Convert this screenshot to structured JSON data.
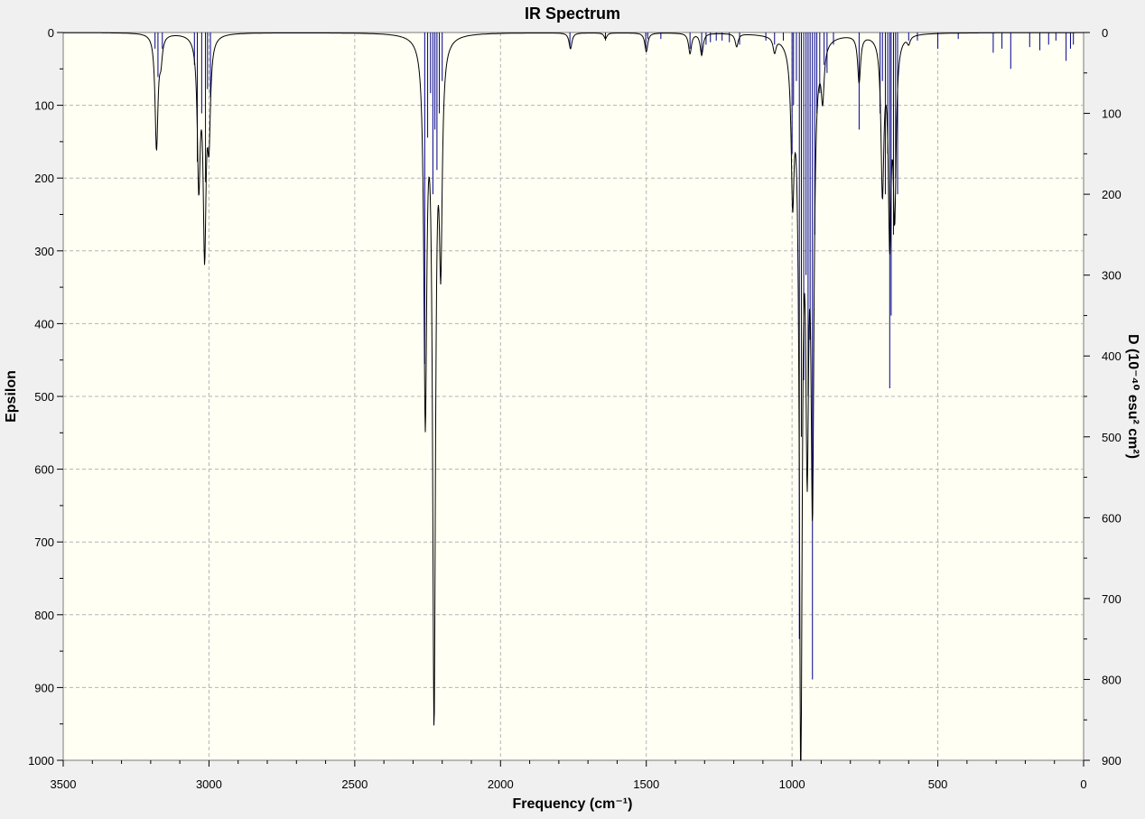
{
  "chart_data": {
    "type": "line",
    "title": "IR Spectrum",
    "xlabel": "Frequency (cm⁻¹)",
    "ylabel": "Epsilon",
    "ylabel_right": "D (10⁻⁴⁰ esu² cm²)",
    "xlim": [
      3500,
      0
    ],
    "ylim": [
      0,
      1000
    ],
    "ylim_right": [
      0,
      900
    ],
    "x_ticks": [
      3500,
      3000,
      2500,
      2000,
      1500,
      1000,
      500,
      0
    ],
    "y_ticks": [
      0,
      100,
      200,
      300,
      400,
      500,
      600,
      700,
      800,
      900,
      1000
    ],
    "y_ticks_right": [
      0,
      100,
      200,
      300,
      400,
      500,
      600,
      700,
      800,
      900
    ],
    "y_inverted": true,
    "grid": true,
    "colors": {
      "plot_background": "#fffff4",
      "spectrum_line": "#000000",
      "stick_lines": "#00008b",
      "gridlines": "#b4b4b4",
      "window_background": "#f0f0f0"
    },
    "series": [
      {
        "role": "spectrum",
        "style": "line",
        "peaks": [
          {
            "x": 3180,
            "y": 158
          },
          {
            "x": 3165,
            "y": 30
          },
          {
            "x": 3035,
            "y": 198
          },
          {
            "x": 3015,
            "y": 286
          },
          {
            "x": 3000,
            "y": 125
          },
          {
            "x": 2258,
            "y": 510
          },
          {
            "x": 2228,
            "y": 922
          },
          {
            "x": 2205,
            "y": 280
          },
          {
            "x": 1760,
            "y": 22
          },
          {
            "x": 1640,
            "y": 8
          },
          {
            "x": 1500,
            "y": 26
          },
          {
            "x": 1350,
            "y": 28
          },
          {
            "x": 1310,
            "y": 30
          },
          {
            "x": 1190,
            "y": 18
          },
          {
            "x": 1060,
            "y": 20
          },
          {
            "x": 998,
            "y": 192
          },
          {
            "x": 970,
            "y": 975
          },
          {
            "x": 948,
            "y": 500
          },
          {
            "x": 930,
            "y": 600
          },
          {
            "x": 895,
            "y": 70
          },
          {
            "x": 770,
            "y": 65
          },
          {
            "x": 690,
            "y": 210
          },
          {
            "x": 665,
            "y": 268
          },
          {
            "x": 648,
            "y": 232
          },
          {
            "x": 600,
            "y": 10
          }
        ]
      },
      {
        "role": "sticks",
        "style": "sticks",
        "axis": "right",
        "x": [
          3185,
          3175,
          3160,
          3050,
          3040,
          3025,
          3012,
          3005,
          2995,
          2260,
          2250,
          2240,
          2232,
          2225,
          2218,
          2210,
          2200,
          1762,
          1640,
          1502,
          1495,
          1450,
          1350,
          1310,
          1295,
          1280,
          1260,
          1240,
          1215,
          1180,
          1090,
          1060,
          1030,
          1000,
          995,
          985,
          975,
          968,
          960,
          952,
          945,
          938,
          930,
          922,
          915,
          905,
          890,
          880,
          858,
          770,
          698,
          690,
          680,
          672,
          665,
          660,
          652,
          645,
          638,
          600,
          570,
          500,
          430,
          310,
          280,
          250,
          185,
          150,
          120,
          95,
          60,
          45,
          35
        ],
        "values": [
          20,
          55,
          20,
          40,
          160,
          100,
          185,
          70,
          80,
          410,
          130,
          75,
          200,
          120,
          170,
          100,
          60,
          18,
          10,
          20,
          8,
          8,
          20,
          25,
          15,
          12,
          10,
          10,
          12,
          15,
          10,
          15,
          10,
          150,
          90,
          60,
          750,
          500,
          430,
          300,
          450,
          380,
          800,
          250,
          100,
          75,
          40,
          50,
          15,
          120,
          100,
          60,
          200,
          150,
          440,
          350,
          250,
          180,
          200,
          10,
          10,
          20,
          8,
          25,
          20,
          45,
          18,
          22,
          15,
          10,
          35,
          20,
          15
        ]
      }
    ]
  }
}
